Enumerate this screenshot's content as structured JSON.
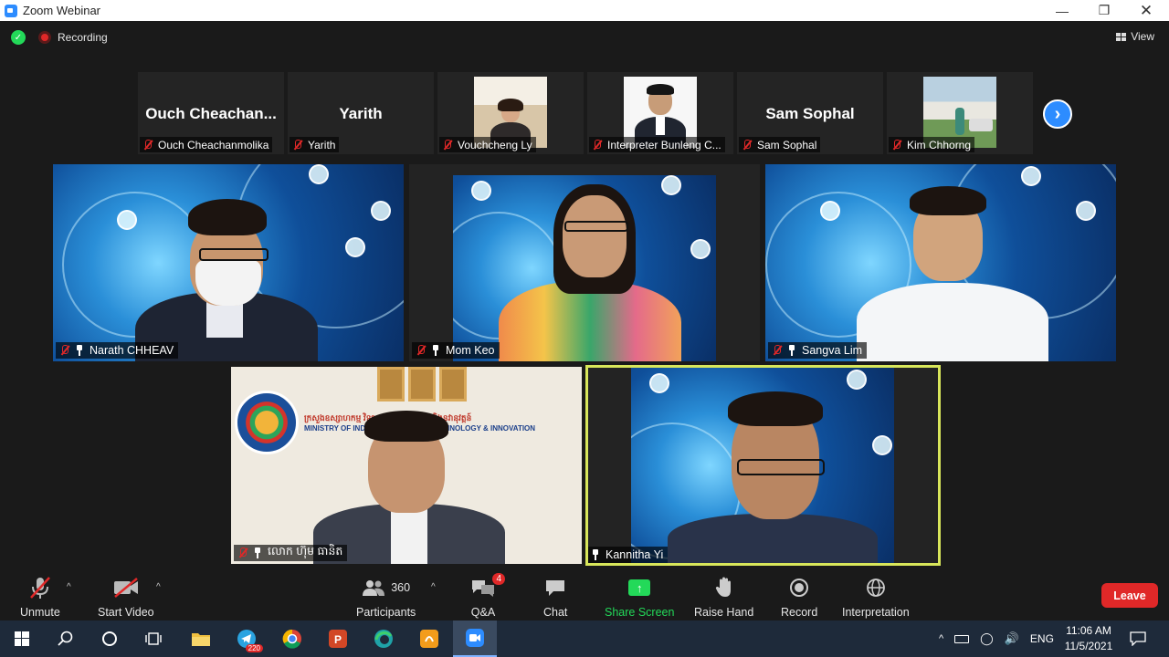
{
  "window": {
    "title": "Zoom Webinar"
  },
  "status": {
    "recording_label": "Recording",
    "view_label": "View"
  },
  "strip": [
    {
      "big_name": "Ouch  Cheachan...",
      "label": "Ouch Cheachanmolika"
    },
    {
      "big_name": "Yarith",
      "label": "Yarith"
    },
    {
      "big_name": "",
      "label": "Vouchcheng Ly"
    },
    {
      "big_name": "",
      "label": "Interpreter Bunleng C..."
    },
    {
      "big_name": "Sam Sophal",
      "label": "Sam Sophal"
    },
    {
      "big_name": "",
      "label": "Kim Chhorng"
    }
  ],
  "tiles": {
    "t1": "Narath CHHEAV",
    "t2": "Mom Keo",
    "t3": "Sangva Lim",
    "t4": "លោក ហ៊ុម ធានិត",
    "t5": "Kannitha Yi"
  },
  "ministry": {
    "line1": "ក្រសួងឧស្សាហកម្ម វិទ្យាសាស្ត្រ បច្ចេកវិទ្យា និងនវានុវត្តន៍",
    "line2": "MINISTRY OF INDUSTRY, SCIENCE, TECHNOLOGY & INNOVATION"
  },
  "toolbar": {
    "unmute": "Unmute",
    "start_video": "Start Video",
    "participants_count": "360",
    "participants": "Participants",
    "qa": "Q&A",
    "qa_badge": "4",
    "chat": "Chat",
    "share": "Share Screen",
    "raise": "Raise Hand",
    "record": "Record",
    "interpretation": "Interpretation",
    "leave": "Leave"
  },
  "taskbar": {
    "telegram_badge": "220",
    "lang": "ENG",
    "time": "11:06 AM",
    "date": "11/5/2021"
  },
  "colors": {
    "zoom_blue": "#2d8cff",
    "share_green": "#23d959",
    "leave_red": "#e02828",
    "active_speaker": "#d8e65a"
  }
}
